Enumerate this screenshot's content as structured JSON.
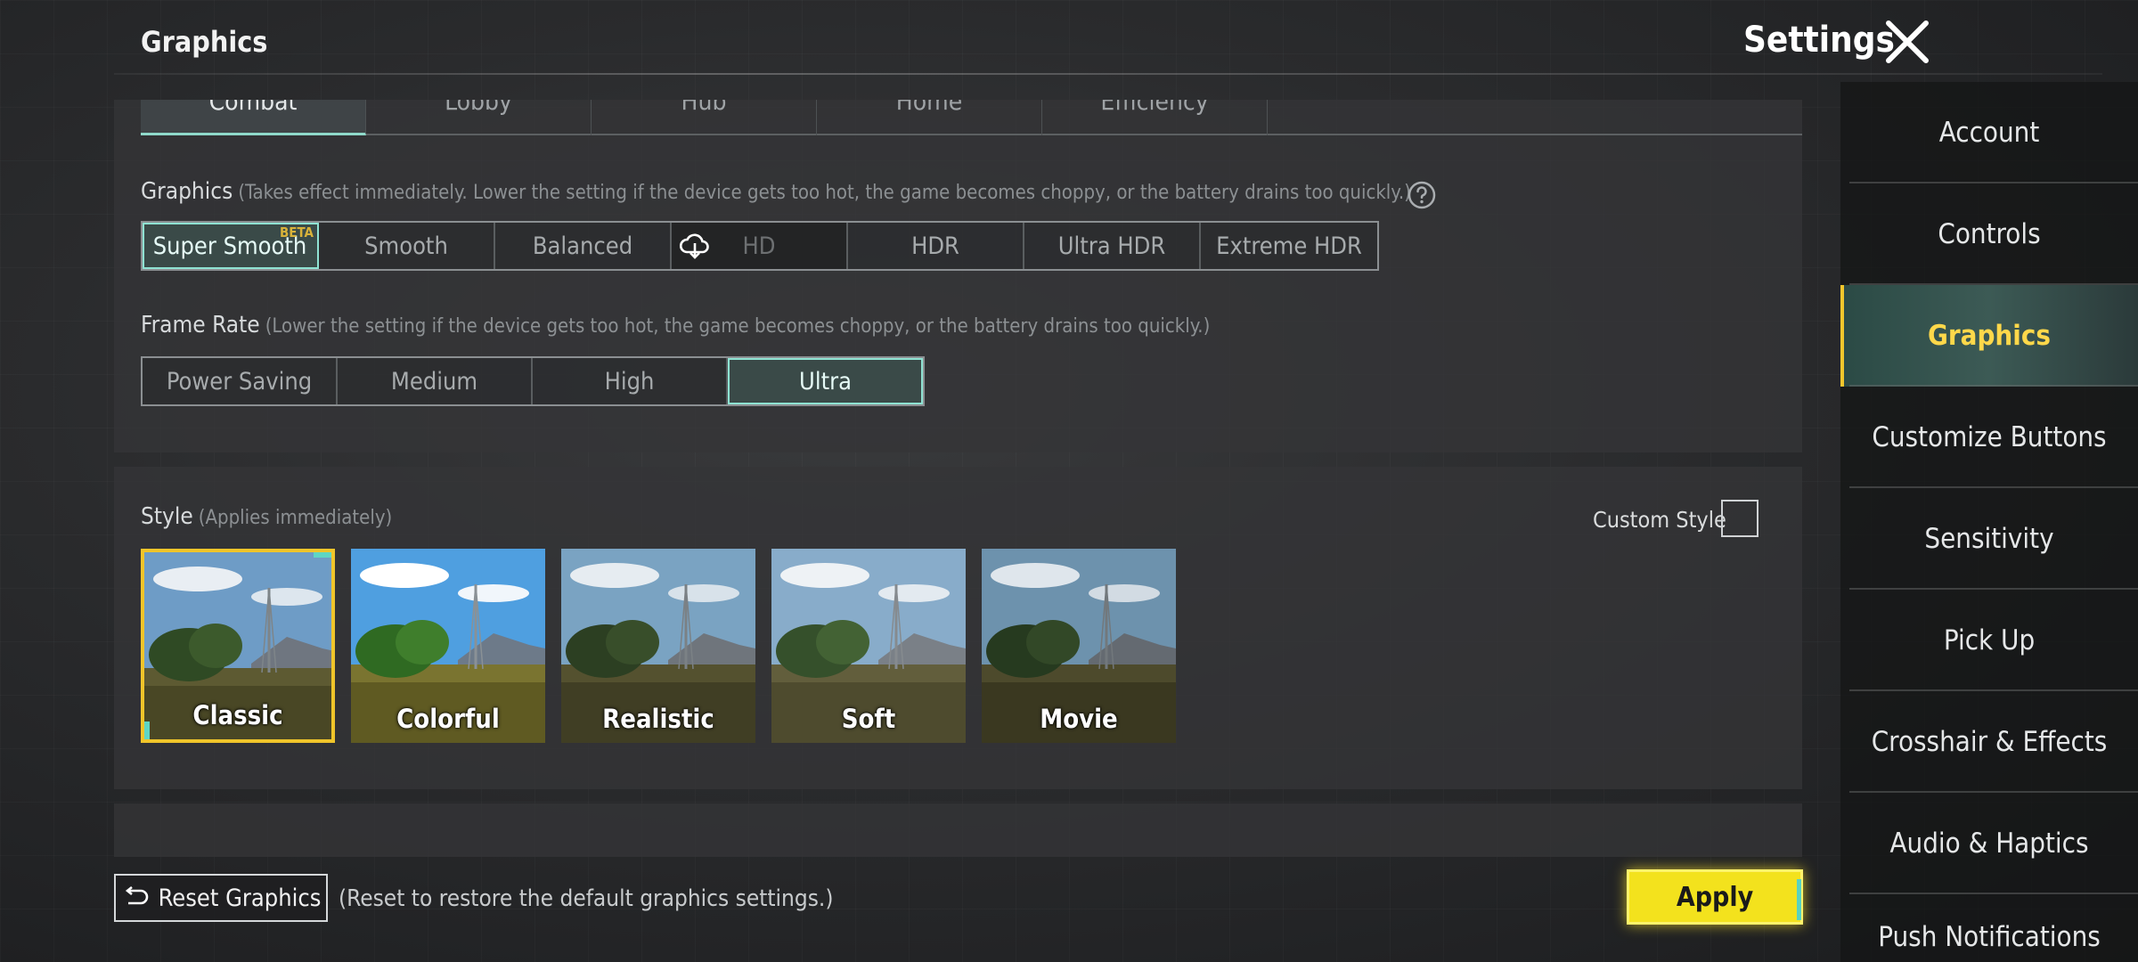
{
  "header": {
    "page_title": "Graphics",
    "settings_title": "Settings"
  },
  "top_tabs": [
    {
      "label": "Combat",
      "active": true
    },
    {
      "label": "Lobby",
      "active": false
    },
    {
      "label": "Hub",
      "active": false
    },
    {
      "label": "Home",
      "active": false
    },
    {
      "label": "Efficiency",
      "active": false
    }
  ],
  "graphics": {
    "label": "Graphics",
    "hint": "(Takes effect immediately. Lower the setting if the device gets too hot, the game becomes choppy, or the battery drains too quickly.)",
    "options": [
      {
        "label": "Super Smooth",
        "badge": "BETA",
        "state": "active"
      },
      {
        "label": "Smooth",
        "state": "normal"
      },
      {
        "label": "Balanced",
        "state": "normal"
      },
      {
        "label": "HD",
        "state": "disabled",
        "icon": "cloud-download-icon"
      },
      {
        "label": "HDR",
        "state": "normal"
      },
      {
        "label": "Ultra HDR",
        "state": "normal"
      },
      {
        "label": "Extreme HDR",
        "state": "normal"
      }
    ]
  },
  "frame_rate": {
    "label": "Frame Rate",
    "hint": "(Lower the setting if the device gets too hot, the game becomes choppy, or the battery drains too quickly.)",
    "options": [
      {
        "label": "Power Saving",
        "state": "normal"
      },
      {
        "label": "Medium",
        "state": "normal"
      },
      {
        "label": "High",
        "state": "normal"
      },
      {
        "label": "Ultra",
        "state": "active"
      }
    ]
  },
  "style": {
    "label": "Style",
    "hint": "(Applies immediately)",
    "custom_style_label": "Custom Style",
    "custom_style_checked": false,
    "presets": [
      {
        "label": "Classic",
        "selected": true
      },
      {
        "label": "Colorful",
        "selected": false
      },
      {
        "label": "Realistic",
        "selected": false
      },
      {
        "label": "Soft",
        "selected": false
      },
      {
        "label": "Movie",
        "selected": false
      }
    ]
  },
  "footer": {
    "reset_label": "Reset Graphics",
    "reset_hint": "(Reset to restore the default graphics settings.)",
    "apply_label": "Apply"
  },
  "sidebar": {
    "items": [
      {
        "label": "Account",
        "active": false
      },
      {
        "label": "Controls",
        "active": false
      },
      {
        "label": "Graphics",
        "active": true
      },
      {
        "label": "Customize Buttons",
        "active": false
      },
      {
        "label": "Sensitivity",
        "active": false
      },
      {
        "label": "Pick Up",
        "active": false
      },
      {
        "label": "Crosshair & Effects",
        "active": false
      },
      {
        "label": "Audio & Haptics",
        "active": false
      },
      {
        "label": "Push Notifications",
        "active": false
      }
    ]
  },
  "colors": {
    "accent_teal": "#8fe3d3",
    "highlight_yellow": "#f3e21d",
    "sidebar_active_text": "#ffd84a"
  }
}
